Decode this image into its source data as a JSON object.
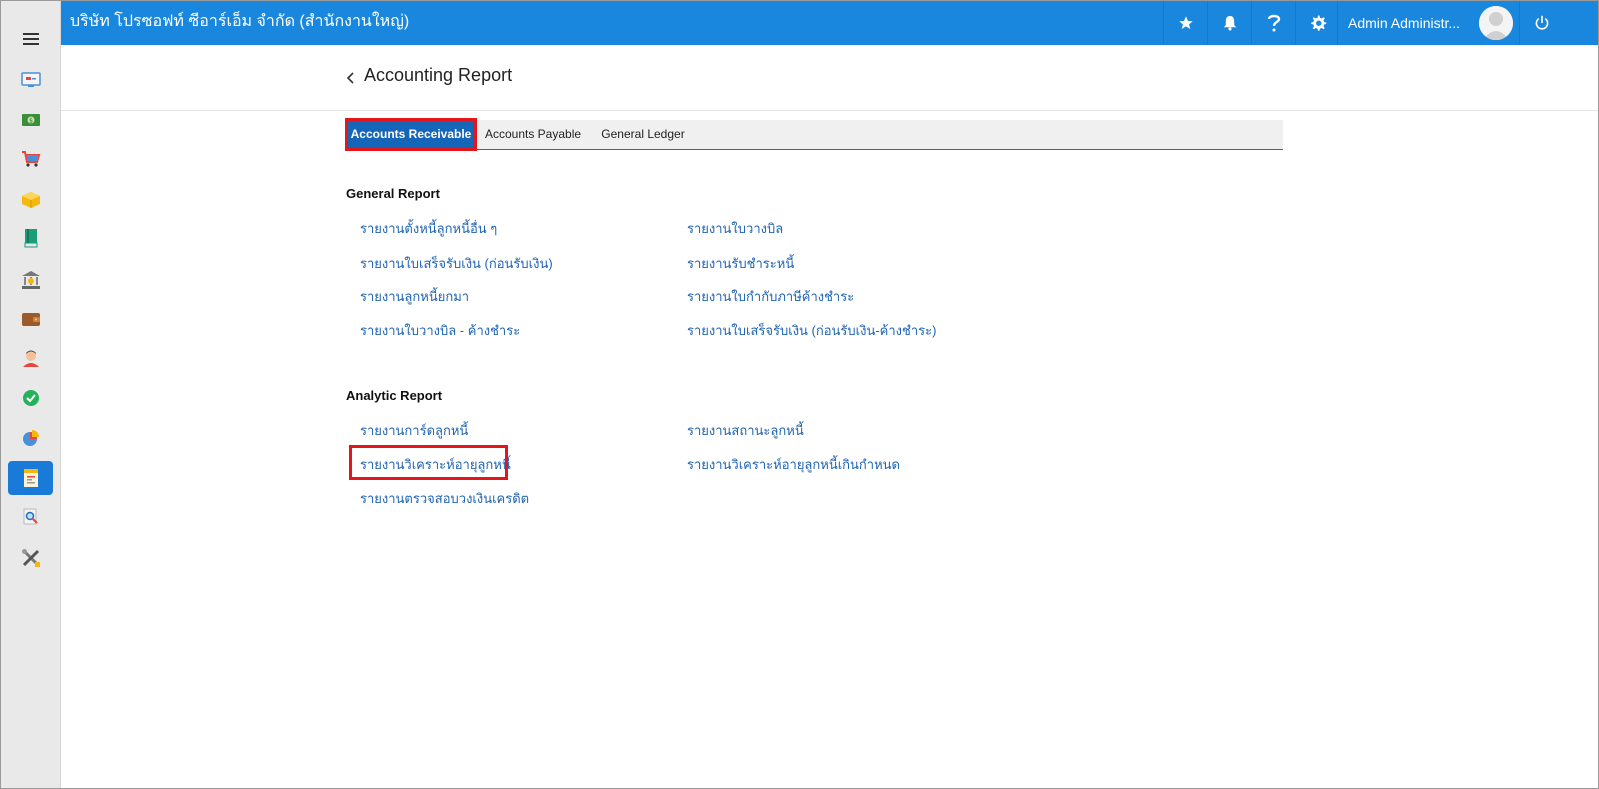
{
  "topbar": {
    "company": "บริษัท โปรซอฟท์ ซีอาร์เอ็ม จำกัด (สำนักงานใหญ่)",
    "user_name": "Admin Administr...",
    "icons": [
      "star-icon",
      "bell-icon",
      "help-icon",
      "gear-icon",
      "power-icon"
    ],
    "color": "#1a87df"
  },
  "sidebar": {
    "items": [
      "dashboard-icon",
      "money-icon",
      "cart-icon",
      "box-icon",
      "book-icon",
      "bank-icon",
      "wallet-icon",
      "person-icon",
      "check-icon",
      "chart-icon",
      "report-icon",
      "search-doc-icon",
      "tools-icon"
    ],
    "active_index": 10
  },
  "page": {
    "title": "Accounting Report"
  },
  "tabs": [
    {
      "label": "Accounts Receivable",
      "active": true
    },
    {
      "label": "Accounts Payable",
      "active": false
    },
    {
      "label": "General Ledger",
      "active": false
    }
  ],
  "general_report": {
    "title": "General Report",
    "left": [
      "รายงานตั้งหนี้ลูกหนี้อื่น ๆ",
      "รายงานใบเสร็จรับเงิน (ก่อนรับเงิน)",
      "รายงานลูกหนี้ยกมา",
      "รายงานใบวางบิล - ค้างชำระ"
    ],
    "right": [
      "รายงานใบวางบิล",
      "รายงานรับชำระหนี้",
      "รายงานใบกำกับภาษีค้างชำระ",
      "รายงานใบเสร็จรับเงิน (ก่อนรับเงิน-ค้างชำระ)"
    ]
  },
  "analytic_report": {
    "title": "Analytic Report",
    "left": [
      "รายงานการ์ดลูกหนี้",
      "รายงานวิเคราะห์อายุลูกหนี้",
      "รายงานตรวจสอบวงเงินเครดิต"
    ],
    "right": [
      "รายงานสถานะลูกหนี้",
      "รายงานวิเคราะห์อายุลูกหนี้เกินกำหนด"
    ]
  },
  "colors": {
    "accent": "#1a87df",
    "link": "#1f63b3",
    "highlight": "#e3161b",
    "active_tab": "#1565b8"
  }
}
